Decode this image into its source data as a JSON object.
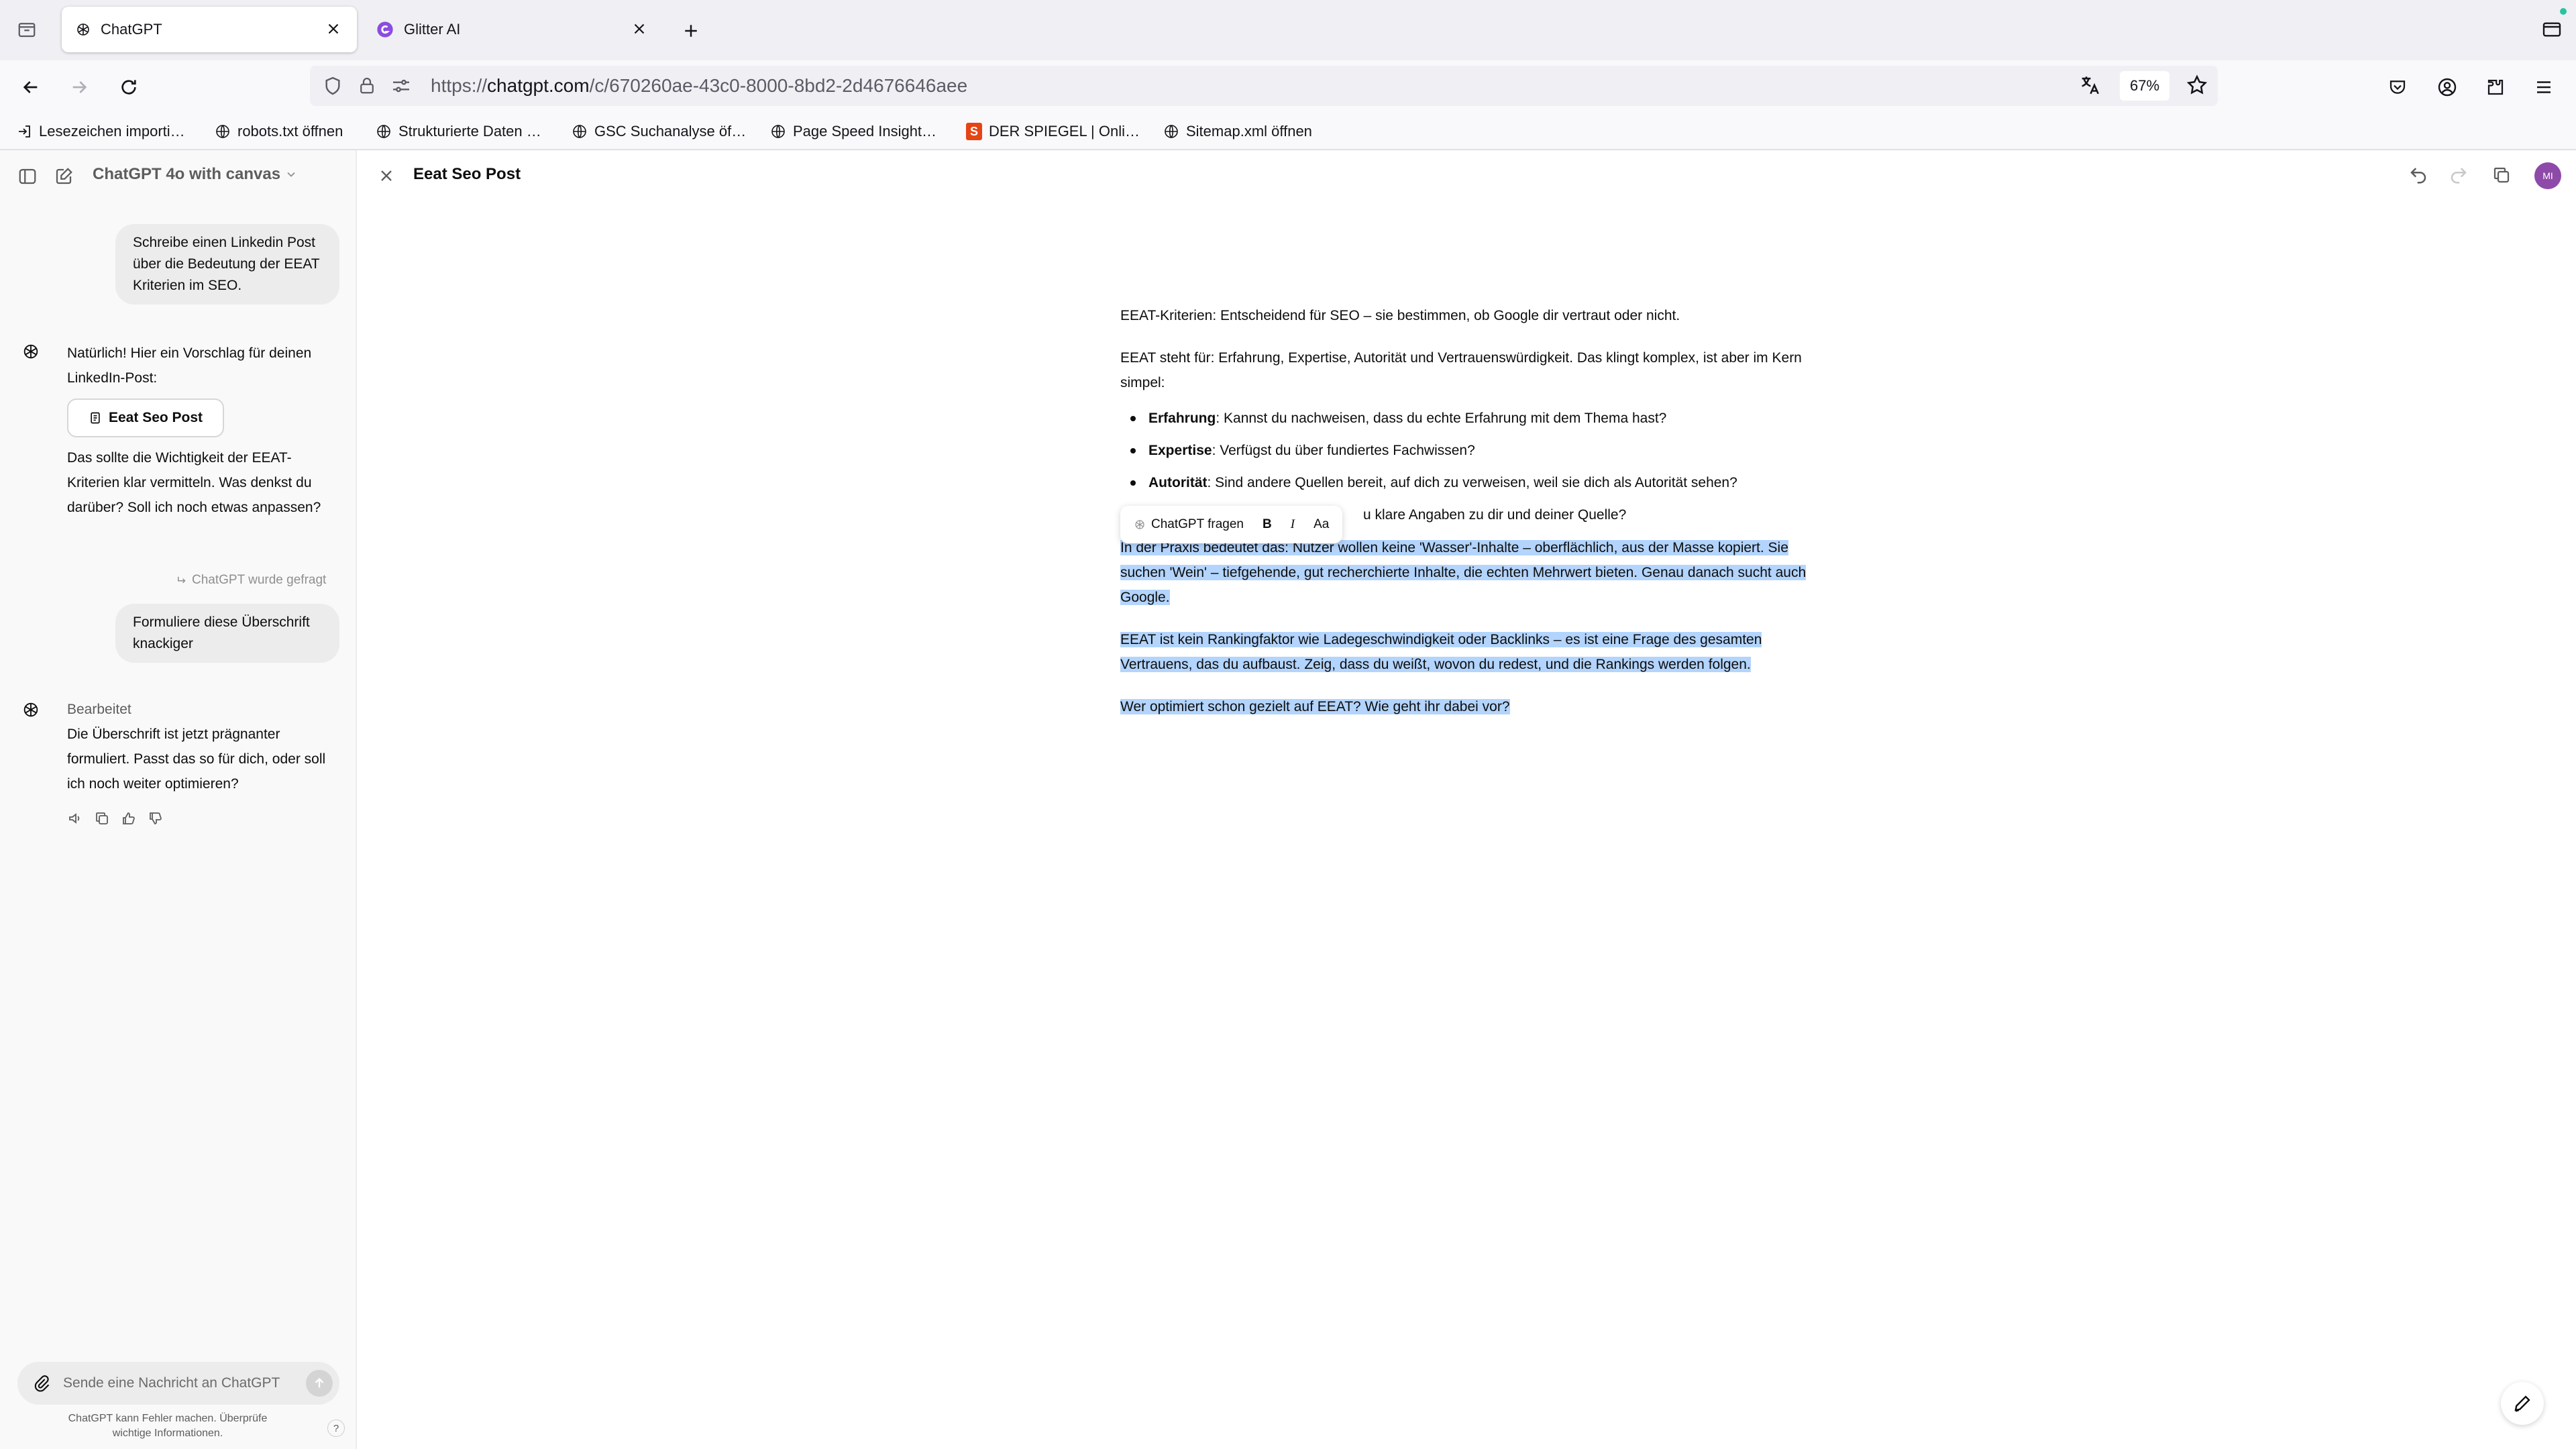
{
  "browser": {
    "tabs": [
      {
        "label": "ChatGPT",
        "active": true
      },
      {
        "label": "Glitter AI",
        "active": false
      }
    ],
    "url": {
      "prefix": "https://",
      "host": "chatgpt.com",
      "path": "/c/670260ae-43c0-8000-8bd2-2d4676646aee"
    },
    "zoom": "67%",
    "bookmarks": [
      {
        "label": "Lesezeichen importi…",
        "icon": "import-icon"
      },
      {
        "label": "robots.txt öffnen",
        "icon": "globe-icon"
      },
      {
        "label": "Strukturierte Daten …",
        "icon": "globe-icon"
      },
      {
        "label": "GSC Suchanalyse öf…",
        "icon": "globe-icon"
      },
      {
        "label": "Page Speed Insight…",
        "icon": "globe-icon"
      },
      {
        "label": "DER SPIEGEL | Onli…",
        "icon": "spiegel-icon"
      },
      {
        "label": "Sitemap.xml öffnen",
        "icon": "globe-icon"
      }
    ]
  },
  "sidebar": {
    "model": "ChatGPT 4o with canvas",
    "messages": {
      "user1": "Schreibe einen Linkedin Post über die Bedeutung der EEAT Kriterien im SEO.",
      "assistant1": "Natürlich! Hier ein Vorschlag für deinen LinkedIn-Post:",
      "canvas_chip": "Eeat Seo Post",
      "assistant1b": "Das sollte die Wichtigkeit der EEAT-Kriterien klar vermitteln. Was denkst du darüber? Soll ich noch etwas anpassen?",
      "asked_note": "ChatGPT wurde gefragt",
      "user2": "Formuliere diese Überschrift knackiger",
      "edited_label": "Bearbeitet",
      "assistant2": "Die Überschrift ist jetzt prägnanter formuliert. Passt das so für dich, oder soll ich noch weiter optimieren?"
    },
    "composer_placeholder": "Sende eine Nachricht an ChatGPT",
    "disclaimer": "ChatGPT kann Fehler machen. Überprüfe wichtige Informationen.",
    "help": "?"
  },
  "canvas": {
    "title": "Eeat Seo Post",
    "avatar_initials": "MI",
    "doc": {
      "heading_line": "EEAT-Kriterien: Entscheidend für SEO – sie bestimmen, ob Google dir vertraut oder nicht.",
      "intro": "EEAT steht für: Erfahrung, Expertise, Autorität und Vertrauenswürdigkeit. Das klingt komplex, ist aber im Kern simpel:",
      "bullets": [
        {
          "term": "Erfahrung",
          "text": ": Kannst du nachweisen, dass du echte Erfahrung mit dem Thema hast?"
        },
        {
          "term": "Expertise",
          "text": ": Verfügst du über fundiertes Fachwissen?"
        },
        {
          "term": "Autorität",
          "text": ": Sind andere Quellen bereit, auf dich zu verweisen, weil sie dich als Autorität sehen?"
        },
        {
          "term": "",
          "text": "u klare Angaben zu dir und deiner Quelle?"
        }
      ],
      "para_praxis": "In der Praxis bedeutet das: Nutzer wollen keine 'Wasser'-Inhalte – oberflächlich, aus der Masse kopiert. Sie suchen 'Wein' – tiefgehende, gut recherchierte Inhalte, die echten Mehrwert bieten. Genau danach sucht auch Google.",
      "para_ranking": "EEAT ist kein Rankingfaktor wie Ladegeschwindigkeit oder Backlinks – es ist eine Frage des gesamten Vertrauens, das du aufbaust. Zeig, dass du weißt, wovon du redest, und die Rankings werden folgen.",
      "closing_question": "Wer optimiert schon gezielt auf EEAT? Wie geht ihr dabei vor?"
    },
    "toolbar": {
      "ask": "ChatGPT fragen",
      "bold": "B",
      "italic": "I",
      "text_size": "Aa"
    }
  },
  "colors": {
    "selection": "#b3d4fc",
    "avatar": "#8e4aa8",
    "chrome_bg": "#f0f0f4"
  }
}
